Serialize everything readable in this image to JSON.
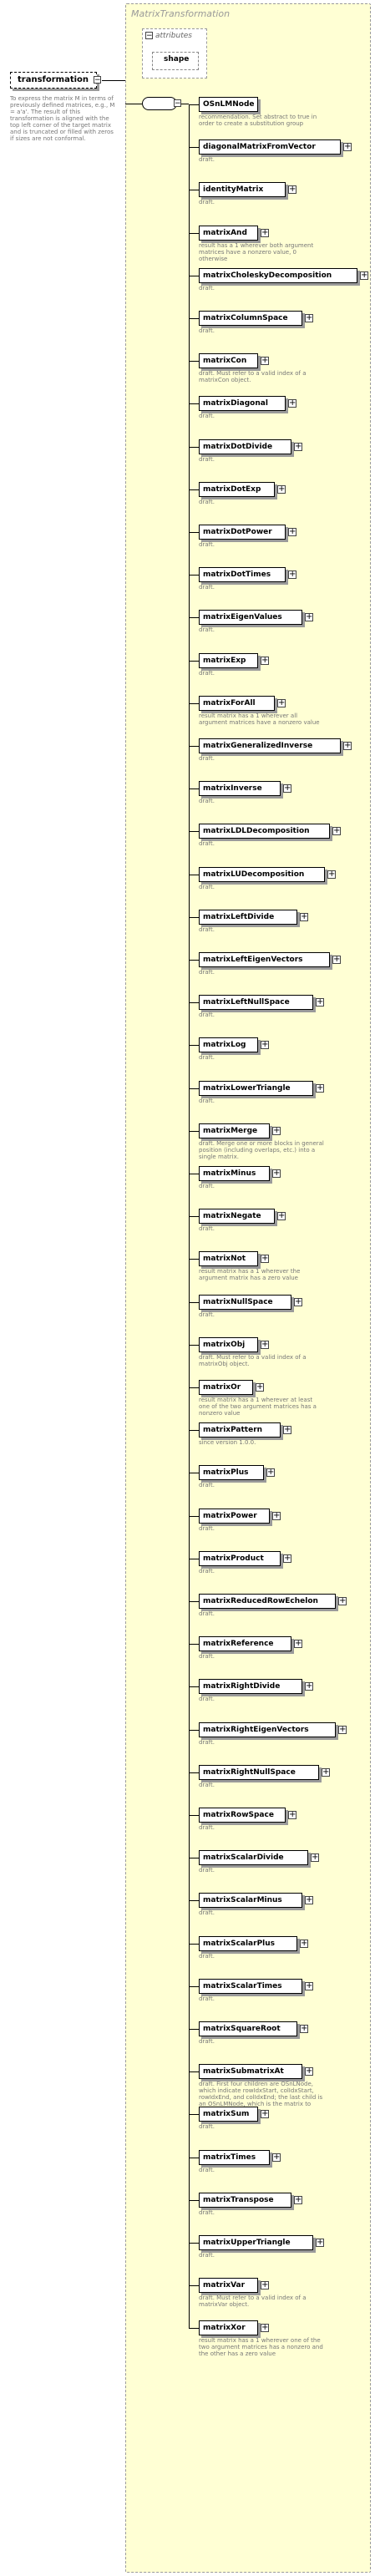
{
  "group": {
    "title": "MatrixTransformation"
  },
  "attributes": {
    "title": "attributes",
    "items": [
      "shape"
    ]
  },
  "root": {
    "name": "transformation",
    "description": "To express the matrix M in terms of previously defined matrices, e.g., M = a'a'. The result of this transformation is aligned with the top left corner of the target matrix and is truncated or filled with zeros if sizes are not conformal."
  },
  "children": [
    {
      "name": "OSnLMNode",
      "desc": "recommendation. Set abstract to true in order to create a substitution group"
    },
    {
      "name": "diagonalMatrixFromVector",
      "desc": "draft."
    },
    {
      "name": "identityMatrix",
      "desc": "draft."
    },
    {
      "name": "matrixAnd",
      "desc": "result has a 1 wherever both argument matrices have a nonzero value, 0 otherwise"
    },
    {
      "name": "matrixCholeskyDecomposition",
      "desc": "draft."
    },
    {
      "name": "matrixColumnSpace",
      "desc": "draft."
    },
    {
      "name": "matrixCon",
      "desc": "draft. Must refer to a valid index of a matrixCon object."
    },
    {
      "name": "matrixDiagonal",
      "desc": "draft."
    },
    {
      "name": "matrixDotDivide",
      "desc": "draft."
    },
    {
      "name": "matrixDotExp",
      "desc": "draft."
    },
    {
      "name": "matrixDotPower",
      "desc": "draft."
    },
    {
      "name": "matrixDotTimes",
      "desc": "draft."
    },
    {
      "name": "matrixEigenValues",
      "desc": "draft."
    },
    {
      "name": "matrixExp",
      "desc": "draft."
    },
    {
      "name": "matrixForAll",
      "desc": "result matrix has a 1 wherever all argument matrices have a nonzero value"
    },
    {
      "name": "matrixGeneralizedInverse",
      "desc": "draft."
    },
    {
      "name": "matrixInverse",
      "desc": "draft."
    },
    {
      "name": "matrixLDLDecomposition",
      "desc": "draft."
    },
    {
      "name": "matrixLUDecomposition",
      "desc": "draft."
    },
    {
      "name": "matrixLeftDivide",
      "desc": "draft."
    },
    {
      "name": "matrixLeftEigenVectors",
      "desc": "draft."
    },
    {
      "name": "matrixLeftNullSpace",
      "desc": "draft."
    },
    {
      "name": "matrixLog",
      "desc": "draft."
    },
    {
      "name": "matrixLowerTriangle",
      "desc": "draft."
    },
    {
      "name": "matrixMerge",
      "desc": "draft. Merge one or more blocks in general position (including overlaps, etc.) into a single matrix."
    },
    {
      "name": "matrixMinus",
      "desc": "draft."
    },
    {
      "name": "matrixNegate",
      "desc": "draft."
    },
    {
      "name": "matrixNot",
      "desc": "result matrix has a 1 wherever the argument matrix has a zero value"
    },
    {
      "name": "matrixNullSpace",
      "desc": "draft."
    },
    {
      "name": "matrixObj",
      "desc": "draft. Must refer to a valid index of a matrixObj object."
    },
    {
      "name": "matrixOr",
      "desc": "result matrix has a 1 wherever at least one of the two argument matrices has a nonzero value"
    },
    {
      "name": "matrixPattern",
      "desc": "since version 1.0.0."
    },
    {
      "name": "matrixPlus",
      "desc": "draft."
    },
    {
      "name": "matrixPower",
      "desc": "draft."
    },
    {
      "name": "matrixProduct",
      "desc": "draft."
    },
    {
      "name": "matrixReducedRowEchelon",
      "desc": "draft."
    },
    {
      "name": "matrixReference",
      "desc": "draft."
    },
    {
      "name": "matrixRightDivide",
      "desc": "draft."
    },
    {
      "name": "matrixRightEigenVectors",
      "desc": "draft."
    },
    {
      "name": "matrixRightNullSpace",
      "desc": "draft."
    },
    {
      "name": "matrixRowSpace",
      "desc": "draft."
    },
    {
      "name": "matrixScalarDivide",
      "desc": "draft."
    },
    {
      "name": "matrixScalarMinus",
      "desc": "draft."
    },
    {
      "name": "matrixScalarPlus",
      "desc": "draft."
    },
    {
      "name": "matrixScalarTimes",
      "desc": "draft."
    },
    {
      "name": "matrixSquareRoot",
      "desc": "draft."
    },
    {
      "name": "matrixSubmatrixAt",
      "desc": "draft. First four children are OSnLNode, which indicate rowIdxStart, colIdxStart, rowIdxEnd, and colIdxEnd; the last child is an OSnLMNode, which is the matrix to crop."
    },
    {
      "name": "matrixSum",
      "desc": "draft."
    },
    {
      "name": "matrixTimes",
      "desc": "draft."
    },
    {
      "name": "matrixTranspose",
      "desc": "draft."
    },
    {
      "name": "matrixUpperTriangle",
      "desc": "draft."
    },
    {
      "name": "matrixVar",
      "desc": "draft. Must refer to a valid index of a matrixVar object."
    },
    {
      "name": "matrixXor",
      "desc": "result matrix has a 1 wherever one of the two argument matrices has a nonzero and the other has a zero value"
    }
  ]
}
